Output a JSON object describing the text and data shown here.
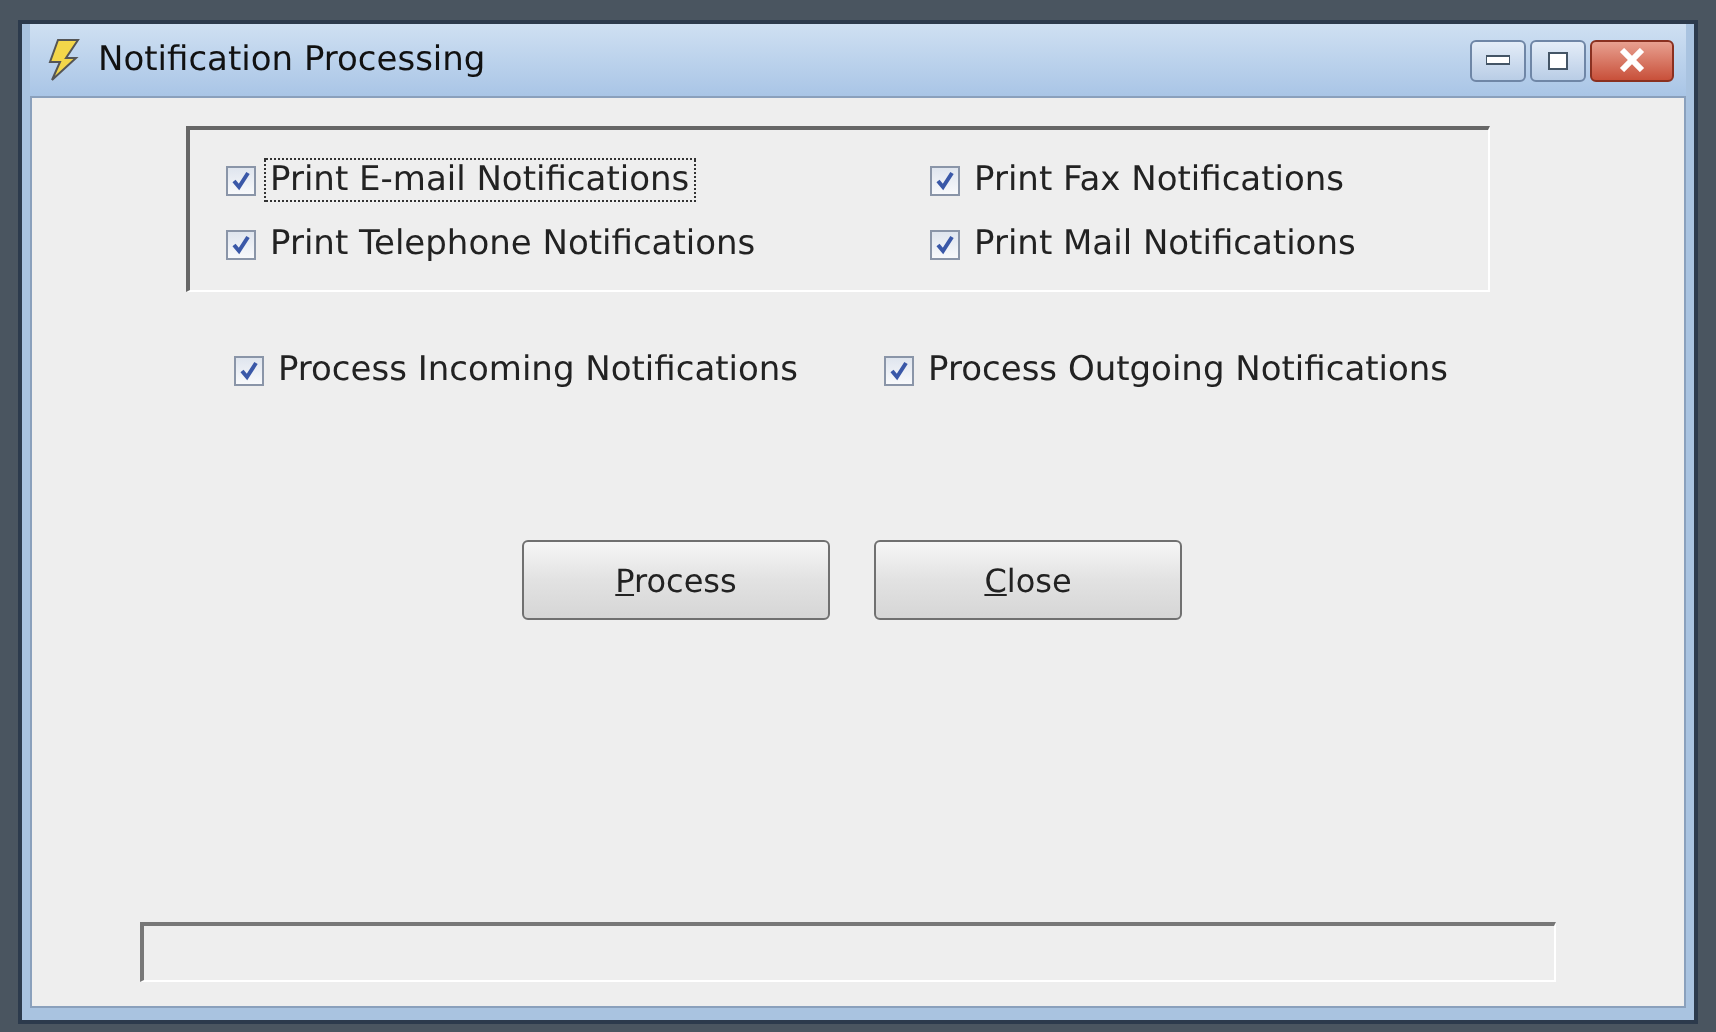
{
  "window": {
    "title": "Notification Processing"
  },
  "print_options": [
    {
      "label": "Print E-mail Notifications",
      "checked": true,
      "focused": true
    },
    {
      "label": "Print Fax Notifications",
      "checked": true,
      "focused": false
    },
    {
      "label": "Print Telephone Notifications",
      "checked": true,
      "focused": false
    },
    {
      "label": "Print Mail Notifications",
      "checked": true,
      "focused": false
    }
  ],
  "process_options": [
    {
      "label": "Process Incoming Notifications",
      "checked": true
    },
    {
      "label": "Process Outgoing Notifications",
      "checked": true
    }
  ],
  "buttons": [
    {
      "label": "Process",
      "mnemonic_first": true
    },
    {
      "label": "Close",
      "mnemonic_first": true
    }
  ]
}
